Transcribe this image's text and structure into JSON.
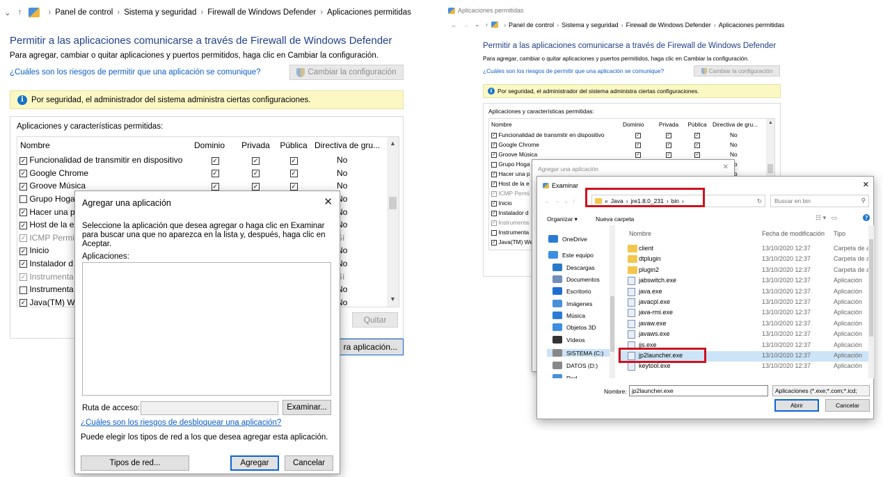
{
  "left": {
    "nav_arrow": "⌄",
    "nav_up": "↑",
    "breadcrumbs": [
      "Panel de control",
      "Sistema y seguridad",
      "Firewall de Windows Defender",
      "Aplicaciones permitidas"
    ],
    "heading": "Permitir a las aplicaciones comunicarse a través de Firewall de Windows Defender",
    "subtext": "Para agregar, cambiar o quitar aplicaciones y puertos permitidos, haga clic en Cambiar la configuración.",
    "risk_link": "¿Cuáles son los riesgos de permitir que una aplicación se comunique?",
    "change_settings": "Cambiar la configuración",
    "info": "Por seguridad, el administrador del sistema administra ciertas configuraciones.",
    "group_label": "Aplicaciones y características permitidas:",
    "columns": [
      "Nombre",
      "Dominio",
      "Privada",
      "Pública",
      "Directiva de gru..."
    ],
    "rows": [
      {
        "name": "Funcionalidad de transmitir en dispositivo",
        "dim": false,
        "checked": true,
        "dom": true,
        "priv": true,
        "pub": true,
        "pol": "No"
      },
      {
        "name": "Google Chrome",
        "dim": false,
        "checked": true,
        "dom": true,
        "priv": true,
        "pub": true,
        "pol": "No"
      },
      {
        "name": "Groove Música",
        "dim": false,
        "checked": true,
        "dom": true,
        "priv": true,
        "pub": true,
        "pol": "No"
      },
      {
        "name": "Grupo Hoga",
        "dim": false,
        "checked": false,
        "dom": false,
        "priv": false,
        "pub": false,
        "pol": "No"
      },
      {
        "name": "Hacer una p",
        "dim": false,
        "checked": true,
        "dom": false,
        "priv": false,
        "pub": false,
        "pol": "No"
      },
      {
        "name": "Host de la e",
        "dim": false,
        "checked": true,
        "dom": false,
        "priv": false,
        "pub": false,
        "pol": "No"
      },
      {
        "name": "ICMP Permi",
        "dim": true,
        "checked": true,
        "dom": false,
        "priv": false,
        "pub": false,
        "pol": "Sí"
      },
      {
        "name": "Inicio",
        "dim": false,
        "checked": true,
        "dom": false,
        "priv": false,
        "pub": false,
        "pol": "No"
      },
      {
        "name": "Instalador d",
        "dim": false,
        "checked": true,
        "dom": false,
        "priv": false,
        "pub": false,
        "pol": "No"
      },
      {
        "name": "Instrumenta",
        "dim": true,
        "checked": true,
        "dom": false,
        "priv": false,
        "pub": false,
        "pol": "Sí"
      },
      {
        "name": "Instrumenta",
        "dim": false,
        "checked": false,
        "dom": false,
        "priv": false,
        "pub": false,
        "pol": "No"
      },
      {
        "name": "Java(TM) We",
        "dim": false,
        "checked": true,
        "dom": false,
        "priv": false,
        "pub": false,
        "pol": "No"
      }
    ],
    "remove_button": "Quitar",
    "allow_other_button": "ra aplicación...",
    "dialog": {
      "title": "Agregar una aplicación",
      "close": "✕",
      "instructions": "Seleccione la aplicación que desea agregar o haga clic en Examinar para buscar una que no aparezca en la lista y, después, haga clic en Aceptar.",
      "apps_label": "Aplicaciones:",
      "path_label": "Ruta de acceso:",
      "path_value": "",
      "browse": "Examinar...",
      "unblock_link": "¿Cuáles son los riesgos de desbloquear una aplicación?",
      "network_text": "Puede elegir los tipos de red a los que desea agregar esta aplicación.",
      "network_types": "Tipos de red...",
      "add": "Agregar",
      "cancel": "Cancelar"
    }
  },
  "right": {
    "window_title": "Aplicaciones permitidas",
    "nav": [
      "←",
      "→",
      "⌄",
      "↑"
    ],
    "breadcrumbs": [
      "Panel de control",
      "Sistema y seguridad",
      "Firewall de Windows Defender",
      "Aplicaciones permitidas"
    ],
    "heading": "Permitir a las aplicaciones comunicarse a través de Firewall de Windows Defender",
    "subtext": "Para agregar, cambiar o quitar aplicaciones y puertos permitidos, haga clic en Cambiar la configuración.",
    "risk_link": "¿Cuáles son los riesgos de permitir que una aplicación se comunique?",
    "change_settings": "Cambiar la configuración",
    "info": "Por seguridad, el administrador del sistema administra ciertas configuraciones.",
    "group_label": "Aplicaciones y características permitidas:",
    "columns": [
      "Nombre",
      "Dominio",
      "Privada",
      "Pública",
      "Directiva de gru..."
    ],
    "rows": [
      {
        "name": "Funcionalidad de transmitir en dispositivo",
        "dim": false,
        "checked": true,
        "dom": true,
        "priv": true,
        "pub": true,
        "pol": "No"
      },
      {
        "name": "Google Chrome",
        "dim": false,
        "checked": true,
        "dom": true,
        "priv": true,
        "pub": true,
        "pol": "No"
      },
      {
        "name": "Groove Música",
        "dim": false,
        "checked": true,
        "dom": true,
        "priv": true,
        "pub": true,
        "pol": "No"
      },
      {
        "name": "Grupo Hoga",
        "dim": false,
        "checked": false,
        "dom": false,
        "priv": false,
        "pub": false,
        "pol": "No"
      },
      {
        "name": "Hacer una p",
        "dim": false,
        "checked": true,
        "dom": false,
        "priv": false,
        "pub": false,
        "pol": "No"
      },
      {
        "name": "Host de la e",
        "dim": false,
        "checked": true,
        "dom": false,
        "priv": false,
        "pub": false,
        "pol": "No"
      },
      {
        "name": "ICMP Permi",
        "dim": true,
        "checked": true,
        "dom": false,
        "priv": false,
        "pub": false,
        "pol": ""
      },
      {
        "name": "Inicio",
        "dim": false,
        "checked": true,
        "dom": false,
        "priv": false,
        "pub": false,
        "pol": ""
      },
      {
        "name": "Instalador d",
        "dim": false,
        "checked": true,
        "dom": false,
        "priv": false,
        "pub": false,
        "pol": ""
      },
      {
        "name": "Instrumenta",
        "dim": true,
        "checked": true,
        "dom": false,
        "priv": false,
        "pub": false,
        "pol": ""
      },
      {
        "name": "Instrumenta",
        "dim": false,
        "checked": false,
        "dom": false,
        "priv": false,
        "pub": false,
        "pol": ""
      },
      {
        "name": "Java(TM) We",
        "dim": false,
        "checked": true,
        "dom": false,
        "priv": false,
        "pub": false,
        "pol": ""
      }
    ],
    "add_dialog_title": "Agregar una aplicación",
    "add_dialog_close": "✕",
    "browse_dialog": {
      "title": "Examinar",
      "close": "✕",
      "path": [
        "«",
        "Java",
        "jre1.8.0_231",
        "bin"
      ],
      "refresh": "↻",
      "search_placeholder": "Buscar en bin",
      "organize": "Organizar ▾",
      "new_folder": "Nueva carpeta",
      "sidebar": [
        {
          "label": "OneDrive",
          "icon": "cloud-icon"
        },
        {
          "label": "Este equipo",
          "icon": "computer-icon"
        },
        {
          "label": "Descargas",
          "icon": "download-icon"
        },
        {
          "label": "Documentos",
          "icon": "document-icon"
        },
        {
          "label": "Escritorio",
          "icon": "desktop-icon"
        },
        {
          "label": "Imágenes",
          "icon": "image-icon"
        },
        {
          "label": "Música",
          "icon": "music-icon"
        },
        {
          "label": "Objetos 3D",
          "icon": "cube-icon"
        },
        {
          "label": "Vídeos",
          "icon": "video-icon"
        },
        {
          "label": "SISTEMA (C:)",
          "icon": "drive-icon"
        },
        {
          "label": "DATOS (D:)",
          "icon": "drive-icon"
        },
        {
          "label": "Red",
          "icon": "network-icon"
        }
      ],
      "columns": [
        "Nombre",
        "Fecha de modificación",
        "Tipo"
      ],
      "files": [
        {
          "name": "client",
          "date": "13/10/2020 12:37",
          "type": "Carpeta de a",
          "kind": "folder"
        },
        {
          "name": "dtplugin",
          "date": "13/10/2020 12:37",
          "type": "Carpeta de a",
          "kind": "folder"
        },
        {
          "name": "plugin2",
          "date": "13/10/2020 12:37",
          "type": "Carpeta de a",
          "kind": "folder"
        },
        {
          "name": "jabswitch.exe",
          "date": "13/10/2020 12:37",
          "type": "Aplicación",
          "kind": "exe"
        },
        {
          "name": "java.exe",
          "date": "13/10/2020 12:37",
          "type": "Aplicación",
          "kind": "exe"
        },
        {
          "name": "javacpl.exe",
          "date": "13/10/2020 12:37",
          "type": "Aplicación",
          "kind": "exe"
        },
        {
          "name": "java-rmi.exe",
          "date": "13/10/2020 12:37",
          "type": "Aplicación",
          "kind": "exe"
        },
        {
          "name": "javaw.exe",
          "date": "13/10/2020 12:37",
          "type": "Aplicación",
          "kind": "exe"
        },
        {
          "name": "javaws.exe",
          "date": "13/10/2020 12:37",
          "type": "Aplicación",
          "kind": "exe"
        },
        {
          "name": "jjs.exe",
          "date": "13/10/2020 12:37",
          "type": "Aplicación",
          "kind": "exe"
        },
        {
          "name": "jp2launcher.exe",
          "date": "13/10/2020 12:37",
          "type": "Aplicación",
          "kind": "exe"
        },
        {
          "name": "keytool.exe",
          "date": "13/10/2020 12:37",
          "type": "Aplicación",
          "kind": "exe"
        }
      ],
      "selected_index": 10,
      "filename_label": "Nombre:",
      "filename_value": "jp2launcher.exe",
      "filter": "Aplicaciones (*.exe;*.com;*.icd;",
      "open": "Abrir",
      "cancel": "Cancelar"
    }
  }
}
